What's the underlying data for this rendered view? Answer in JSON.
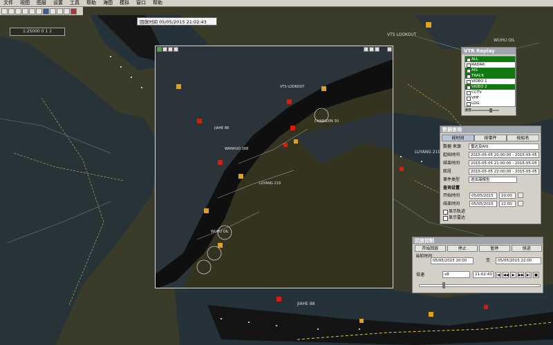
{
  "menu": [
    "文件",
    "视图",
    "图层",
    "设置",
    "工具",
    "帮助",
    "海图",
    "模拟",
    "窗口",
    "帮助"
  ],
  "scale_label": "1:25000  0  1  2",
  "info_tab": "回放时间  05/05/2015 21:02:43",
  "map_labels": [
    "VTS LOOKOUT",
    "WUHU OIL",
    "LUYANG 219",
    "JIAHE 88",
    "WANHUO 168",
    "CHANGXIN 30"
  ],
  "vtr": {
    "title": "VTR Replay Control",
    "rows": [
      {
        "label": "ALL",
        "on": true
      },
      {
        "label": "RADAR",
        "on": false
      },
      {
        "label": "AIS",
        "on": true
      },
      {
        "label": "TRACK",
        "on": true
      },
      {
        "label": "VIDEO 1",
        "on": false
      },
      {
        "label": "VIDEO 2",
        "on": true
      },
      {
        "label": "CCTV",
        "on": false
      },
      {
        "label": "VHF",
        "on": false
      },
      {
        "label": "LOG",
        "on": false
      }
    ],
    "speed_label": "速度"
  },
  "search": {
    "title": "数据查询",
    "tabs": [
      "按时间",
      "按事件",
      "按船名"
    ],
    "rows": [
      {
        "label": "数据  来源",
        "value": "雷达及AIS"
      },
      {
        "label": "起始时间",
        "value": "2015-05-05 20:00:00 - 2015-05-05 21:00:00"
      },
      {
        "label": "结束时间",
        "value": "2015-05-05 21:00:00 - 2015-05-05 22:00:00"
      },
      {
        "label": "航段",
        "value": "2015-05-05 22:00:00 - 2015-05-05 23:00:00"
      },
      {
        "label": "事件类型",
        "value": "进出港报告"
      }
    ],
    "section": "查询设置",
    "start": {
      "label": "开始时间",
      "date": "05/05/2015",
      "time": "20:00"
    },
    "end": {
      "label": "结束时间",
      "date": "05/05/2015",
      "time": "22:00"
    },
    "checks": [
      "显示轨迹",
      "显示雷达",
      "显示标注"
    ]
  },
  "replay": {
    "title": "回放控制",
    "buttons": [
      "开始回放",
      "停止",
      "暂停",
      "快进"
    ],
    "label1": "当前时间",
    "time_start": "05/05/2015 20:00",
    "label2": "至",
    "time_end": "05/05/2015 22:00",
    "speed_label": "倍速",
    "speed_value": "x8",
    "current": "21:02:43",
    "controls": [
      "|◀",
      "◀◀",
      "▶",
      "▶▶",
      "▶|",
      "■"
    ]
  }
}
